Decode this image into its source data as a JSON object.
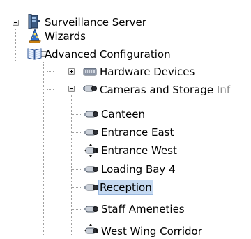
{
  "tree": {
    "nodes": [
      {
        "label": "Surveillance Server",
        "icon": "server-icon",
        "expanded": true
      },
      {
        "label": "Wizards",
        "icon": "wizard-hat-icon"
      },
      {
        "label": "Advanced Configuration",
        "icon": "open-book-icon",
        "expanded": true
      },
      {
        "label": "Hardware Devices",
        "icon": "hardware-device-icon",
        "expanded": false
      },
      {
        "label": "Cameras and Storage",
        "suffix": "Inf",
        "icon": "camera-icon",
        "expanded": true
      },
      {
        "label": "Canteen",
        "icon": "camera-icon"
      },
      {
        "label": "Entrance East",
        "icon": "camera-icon"
      },
      {
        "label": "Entrance West",
        "icon": "ptz-camera-icon"
      },
      {
        "label": "Loading Bay 4",
        "icon": "camera-icon"
      },
      {
        "label": "Reception",
        "icon": "camera-icon",
        "selected": true
      },
      {
        "label": "Staff Ameneties",
        "icon": "camera-icon"
      },
      {
        "label": "West Wing Corridor",
        "icon": "ptz-camera-icon"
      }
    ]
  },
  "colors": {
    "selection": "#c5d9f1",
    "tree_lines": "#a0a0a0",
    "suffix_text": "#8a8a8a"
  }
}
